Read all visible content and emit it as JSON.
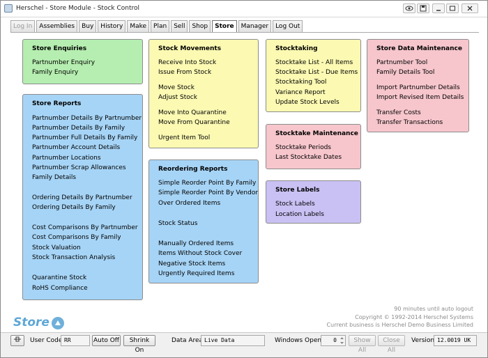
{
  "window": {
    "title": "Herschel - Store Module - Stock Control"
  },
  "menu": {
    "tabs": [
      "Log In",
      "Assemblies",
      "Buy",
      "History",
      "Make",
      "Plan",
      "Sell",
      "Shop",
      "Store",
      "Manager",
      "Log Out"
    ],
    "active": "Store"
  },
  "panels": {
    "enquiries": {
      "title": "Store Enquiries",
      "items": [
        "Partnumber Enquiry",
        "Family Enquiry"
      ]
    },
    "movements": {
      "title": "Stock Movements",
      "items": [
        "Receive Into Stock",
        "Issue From Stock",
        "Move Stock",
        "Adjust Stock",
        "Move Into Quarantine",
        "Move From Quarantine",
        "Urgent Item Tool"
      ]
    },
    "stocktaking": {
      "title": "Stocktaking",
      "items": [
        "Stocktake List - All Items",
        "Stocktake List - Due Items",
        "Stocktaking Tool",
        "Variance Report",
        "Update Stock Levels"
      ]
    },
    "maintenance": {
      "title": "Store Data Maintenance",
      "items": [
        "Partnumber Tool",
        "Family Details Tool",
        "Import Partnumber Details",
        "Import Revised Item Details",
        "Transfer Costs",
        "Transfer Transactions"
      ]
    },
    "reports": {
      "title": "Store Reports",
      "items": [
        "Partnumber Details By Partnumber",
        "Partnumber Details By Family",
        "Partnumber Full Details By Family",
        "Partnumber Account Details",
        "Partnumber Locations",
        "Partnumber Scrap Allowances",
        "Family Details",
        "Ordering Details By Partnumber",
        "Ordering Details By Family",
        "Cost Comparisons By Partnumber",
        "Cost Comparisons By Family",
        "Stock Valuation",
        "Stock Transaction Analysis",
        "Quarantine Stock",
        "RoHS Compliance"
      ]
    },
    "stocktake_maint": {
      "title": "Stocktake Maintenance",
      "items": [
        "Stocktake Periods",
        "Last Stocktake Dates"
      ]
    },
    "reordering": {
      "title": "Reordering Reports",
      "items": [
        "Simple Reorder Point By Family",
        "Simple Reorder Point By Vendor",
        "Over Ordered Items",
        "Stock Status",
        "Manually Ordered Items",
        "Items Without Stock Cover",
        "Negative Stock Items",
        "Urgently Required Items"
      ]
    },
    "labels": {
      "title": "Store Labels",
      "items": [
        "Stock Labels",
        "Location Labels"
      ]
    }
  },
  "info": {
    "logout": "90 minutes until auto logout",
    "copyright": "Copyright © 1992-2014 Herschel Systems",
    "business": "Current business is Herschel Demo Business Limited"
  },
  "logo": "Store",
  "status": {
    "user_code_label": "User Code",
    "user_code": "RR",
    "auto_off": "Auto Off",
    "shrink_on": "Shrink On",
    "data_area_label": "Data Area",
    "data_area": "Live Data",
    "windows_open_label": "Windows Open",
    "windows_open": "0",
    "show_all": "Show All",
    "close_all": "Close All",
    "version_label": "Version",
    "version": "12.0019 UK"
  },
  "icons": {
    "app": "herschel-app-icon",
    "eye": "eye-icon",
    "save": "save-icon",
    "minimize": "minimize-icon",
    "maximize": "maximize-icon",
    "close": "close-icon",
    "pin": "pin-icon",
    "spinner": "spinner-icon"
  },
  "colors": {
    "green": "#b5eeb0",
    "blue": "#a6d4f6",
    "yellow": "#fbf9b2",
    "pink": "#f6c6cc",
    "purple": "#c9c1f3",
    "logo": "#5fa7d6"
  }
}
